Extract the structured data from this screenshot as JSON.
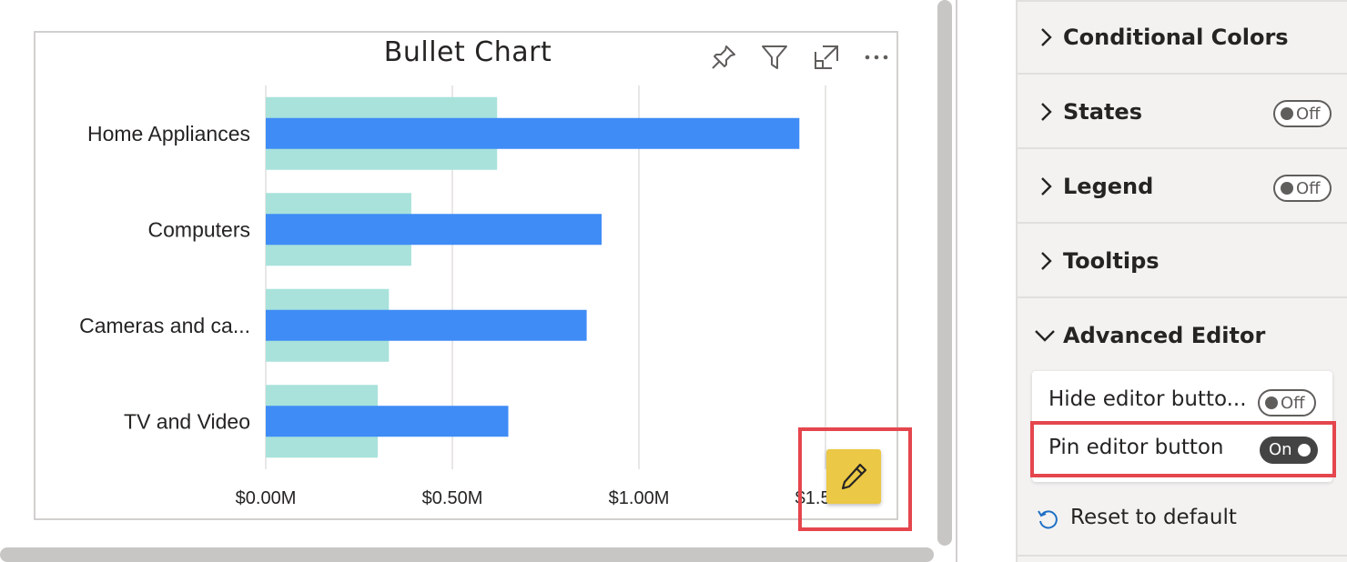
{
  "visual": {
    "title": "Bullet Chart",
    "icons": [
      "pin-icon",
      "filter-icon",
      "focus-mode-icon",
      "more-options-icon"
    ],
    "edit_icon": "pencil-icon"
  },
  "chart_data": {
    "type": "bar",
    "orientation": "horizontal",
    "title": "Bullet Chart",
    "categories": [
      "Home Appliances",
      "Computers",
      "Cameras and ca...",
      "TV and Video"
    ],
    "series": [
      {
        "color": "#a8e2db",
        "values": [
          0.62,
          0.39,
          0.33,
          0.3
        ]
      },
      {
        "color": "#3f8cf6",
        "values": [
          1.43,
          0.9,
          0.86,
          0.65
        ]
      }
    ],
    "x_ticks": [
      0,
      0.5,
      1.0,
      1.5
    ],
    "x_tick_labels": [
      "$0.00M",
      "$0.50M",
      "$1.00M",
      "$1.50M"
    ],
    "xlim": [
      0,
      1.5
    ],
    "grid": true,
    "legend": "none"
  },
  "format_pane": {
    "sections": [
      {
        "label": "Conditional Colors",
        "expanded": false,
        "toggle": null
      },
      {
        "label": "States",
        "expanded": false,
        "toggle": "Off"
      },
      {
        "label": "Legend",
        "expanded": false,
        "toggle": "Off"
      },
      {
        "label": "Tooltips",
        "expanded": false,
        "toggle": null
      },
      {
        "label": "Advanced Editor",
        "expanded": true,
        "toggle": null
      }
    ],
    "advanced_editor": {
      "hide_editor_label": "Hide editor butto...",
      "hide_editor_toggle": "Off",
      "pin_editor_label": "Pin editor button",
      "pin_editor_toggle": "On",
      "reset_label": "Reset to default"
    }
  },
  "colors": {
    "highlight": "#e5464d",
    "edit_button": "#ebc845",
    "target_bar": "#a8e2db",
    "actual_bar": "#3f8cf6"
  }
}
